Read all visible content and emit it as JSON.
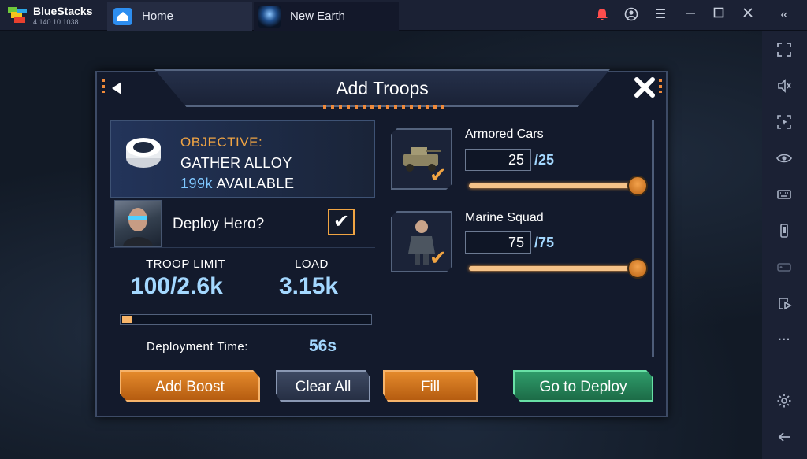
{
  "titlebar": {
    "app_name": "BlueStacks",
    "app_version": "4.140.10.1038",
    "tabs": [
      {
        "label": "Home"
      },
      {
        "label": "New Earth"
      }
    ]
  },
  "dialog": {
    "title": "Add Troops",
    "objective": {
      "label": "OBJECTIVE:",
      "text": "GATHER ALLOY",
      "available_num": "199k",
      "available_word": "AVAILABLE"
    },
    "hero": {
      "label": "Deploy Hero?",
      "checked": true,
      "check_glyph": "✔"
    },
    "stats": {
      "troop_limit_label": "TROOP LIMIT",
      "troop_limit_value": "100/2.6k",
      "load_label": "LOAD",
      "load_value": "3.15k"
    },
    "load_progress": 0.04,
    "deployment": {
      "label": "Deployment Time:",
      "value": "56s"
    },
    "troops": [
      {
        "name": "Armored Cars",
        "value": "25",
        "max": "/25",
        "fill": 1.0
      },
      {
        "name": "Marine Squad",
        "value": "75",
        "max": "/75",
        "fill": 1.0
      }
    ],
    "buttons": {
      "add_boost": "Add Boost",
      "clear_all": "Clear All",
      "fill": "Fill",
      "go_to_deploy": "Go to Deploy"
    }
  },
  "colors": {
    "accent_orange": "#f0a443",
    "value_blue": "#a4d8ff",
    "button_green": "#2f9c6a"
  },
  "icons": {
    "back": "back-arrow-icon",
    "close": "close-icon",
    "objective": "alloy-icon"
  }
}
